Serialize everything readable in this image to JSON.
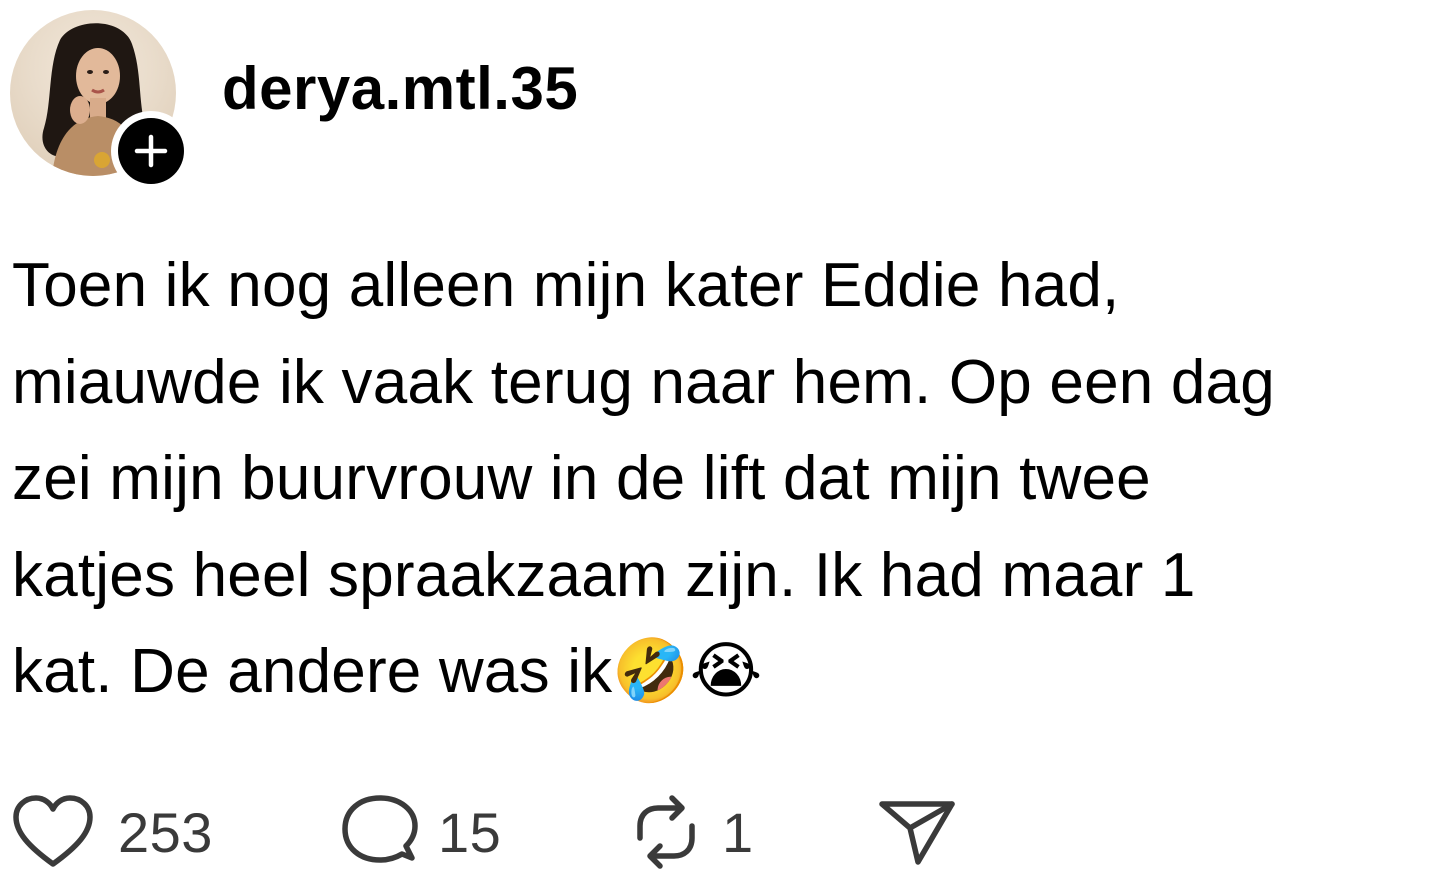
{
  "post": {
    "username": "derya.mtl.35",
    "text": "Toen ik nog alleen mijn kater Eddie had,\nmiauwde ik vaak terug naar hem. Op een dag\nzei mijn buurvrouw in de lift dat mijn twee\nkatjes heel spraakzaam zijn. Ik had maar 1\nkat. De andere was ik🤣😭"
  },
  "actions": {
    "likes": "253",
    "replies": "15",
    "reposts": "1"
  },
  "icons": {
    "avatar": "profile-photo",
    "follow": "plus-icon",
    "like": "heart-icon",
    "reply": "speech-bubble-icon",
    "repost": "repost-icon",
    "share": "paper-plane-icon"
  },
  "colors": {
    "text": "#000000",
    "count": "#3a3a3a",
    "background": "#ffffff"
  }
}
